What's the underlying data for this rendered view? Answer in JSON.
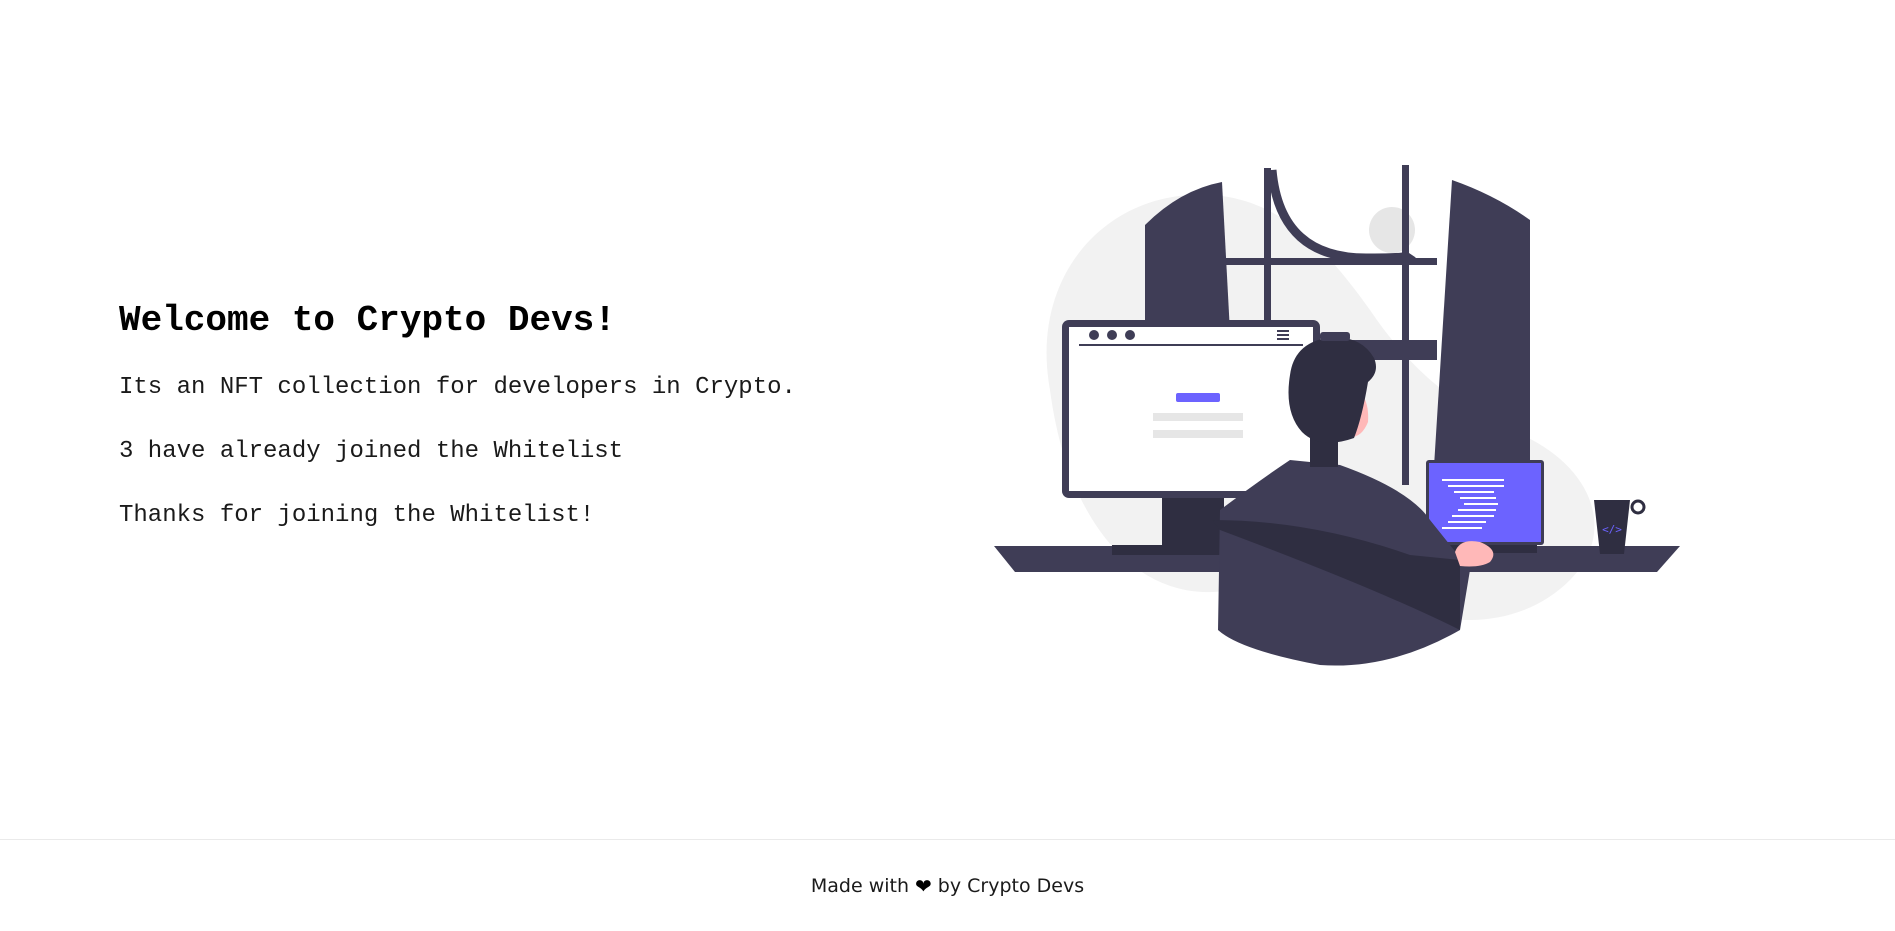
{
  "main": {
    "title": "Welcome to Crypto Devs!",
    "description": "Its an NFT collection for developers in Crypto.",
    "joined_text": "3 have already joined the Whitelist",
    "status_text": "Thanks for joining the Whitelist!"
  },
  "illustration": {
    "accent_color": "#6c63ff",
    "dark_color": "#3f3d56"
  },
  "footer": {
    "prefix": "Made with",
    "heart_glyph": "❤",
    "suffix": "by Crypto Devs"
  }
}
